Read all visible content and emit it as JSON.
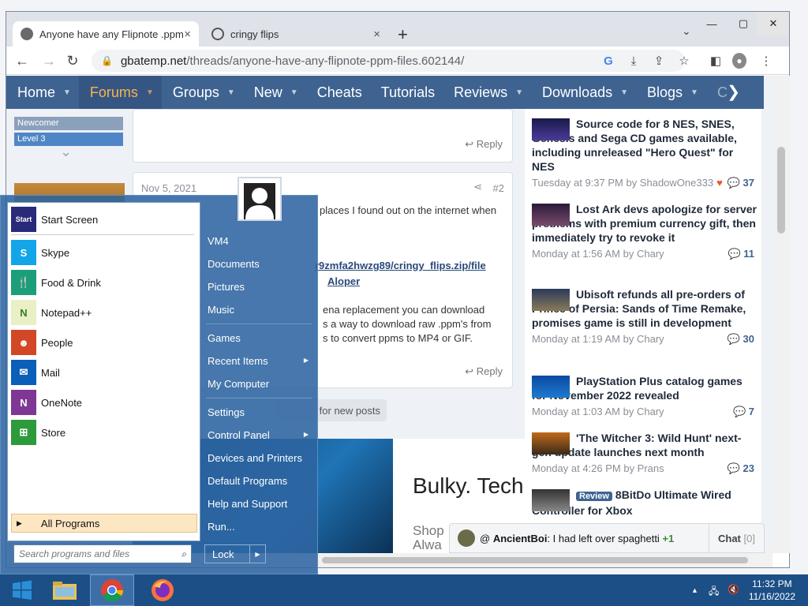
{
  "browser": {
    "tabs": [
      {
        "title": "Anyone have any Flipnote .ppm",
        "close": "×"
      },
      {
        "title": "cringy flips",
        "close": "×"
      }
    ],
    "new_tab": "+",
    "url_host": "gbatemp.net",
    "url_path": "/threads/anyone-have-any-flipnote-ppm-files.602144/"
  },
  "site": {
    "nav": [
      "Home",
      "Forums",
      "Groups",
      "New",
      "Cheats",
      "Tutorials",
      "Reviews",
      "Downloads",
      "Blogs",
      "C"
    ],
    "ranks": [
      "Newcomer",
      "Level 3"
    ],
    "post1_reply": "Reply",
    "post2": {
      "date": "Nov 5, 2021",
      "num": "#2",
      "line1": "places I found out on the internet when",
      "link1": "r9zmfa2hwzg89/cringy_flips.zip/file",
      "link2": "Aloper",
      "line3": "ena replacement you can download",
      "line4": "s a way to download raw .ppm's from",
      "line5": "s to convert ppms to MP4 or GIF.",
      "reply": "Reply"
    },
    "new_posts": "for new posts",
    "ad": {
      "title": "Bulky. Tech",
      "sub1": "Shop",
      "sub2": "Alwa"
    }
  },
  "sidebar": {
    "news": [
      {
        "title": "Source code for 8 NES, SNES, Genesis and Sega CD games available, including unreleased \"Hero Quest\" for NES",
        "meta": "Tuesday at 9:37 PM by ShadowOne333",
        "count": "37"
      },
      {
        "title": "Lost Ark devs apologize for server problems with premium currency gift, then immediately try to revoke it",
        "meta": "Monday at 1:56 AM by Chary",
        "count": "11"
      },
      {
        "title": "Ubisoft refunds all pre-orders of Prince of Persia: Sands of Time Remake, promises game is still in development",
        "meta": "Monday at 1:19 AM by Chary",
        "count": "30"
      },
      {
        "title": "PlayStation Plus catalog games for November 2022 revealed",
        "meta": "Monday at 1:03 AM by Chary",
        "count": "7"
      },
      {
        "title": "'The Witcher 3: Wild Hunt' next-gen update launches next month",
        "meta": "Monday at 4:26 PM by Prans",
        "count": "23"
      },
      {
        "badge": "Review",
        "title": "8BitDo Ultimate Wired Controller for Xbox"
      }
    ]
  },
  "chat": {
    "user": "AncientBoi",
    "message": "I had left over spaghetti",
    "plus": "+1",
    "button": "Chat",
    "count": "[0]"
  },
  "start_menu": {
    "left_items": [
      "Start Screen",
      "Skype",
      "Food & Drink",
      "Notepad++",
      "People",
      "Mail",
      "OneNote",
      "Store"
    ],
    "all_programs": "All Programs",
    "search_placeholder": "Search programs and files",
    "right_items": [
      "VM4",
      "Documents",
      "Pictures",
      "Music",
      "Games",
      "Recent Items",
      "My Computer",
      "Settings",
      "Control Panel",
      "Devices and Printers",
      "Default Programs",
      "Help and Support",
      "Run..."
    ],
    "lock": "Lock",
    "start_tile": "Start"
  },
  "taskbar": {
    "time": "11:32 PM",
    "date": "11/16/2022"
  }
}
